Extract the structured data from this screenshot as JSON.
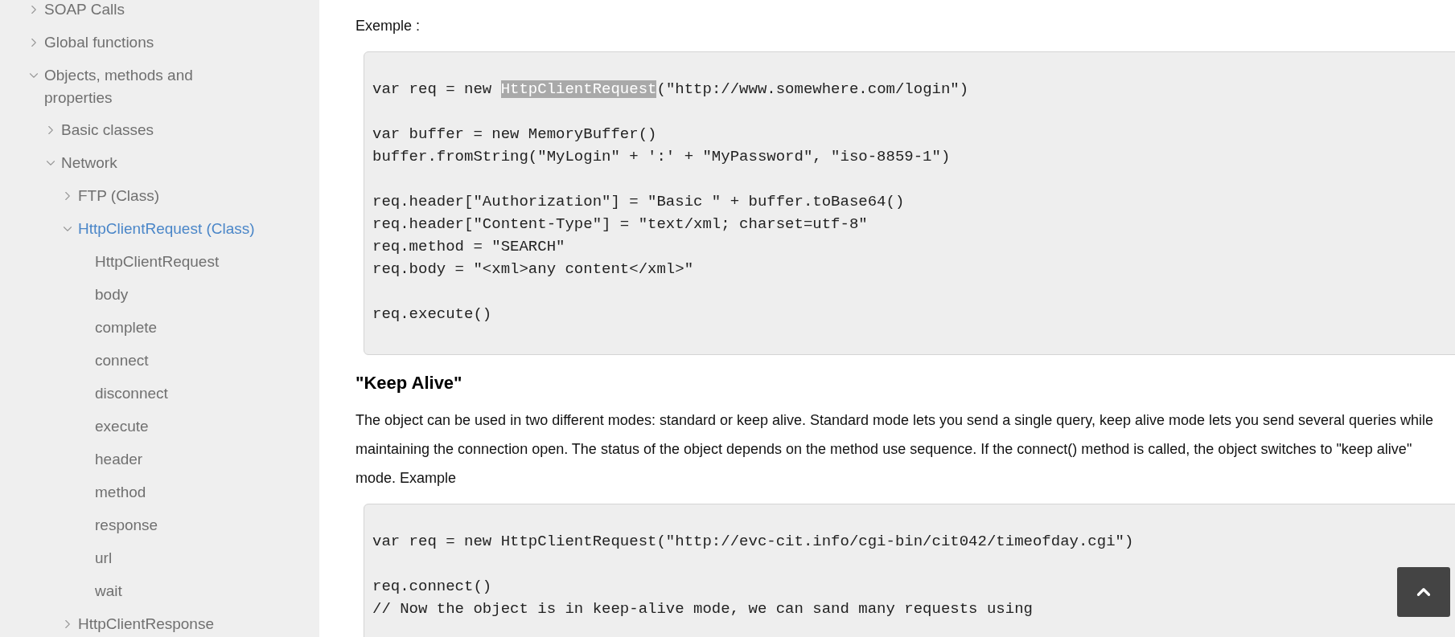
{
  "sidebar": {
    "items": [
      {
        "label": "SOAP Calls",
        "kind": "folder",
        "expanded": false,
        "selected": false
      },
      {
        "label": "Global functions",
        "kind": "folder",
        "expanded": false,
        "selected": false
      },
      {
        "label": "Objects, methods and properties",
        "kind": "folder",
        "expanded": true,
        "selected": false,
        "children": [
          {
            "label": "Basic classes",
            "kind": "folder",
            "expanded": false,
            "selected": false
          },
          {
            "label": "Network",
            "kind": "folder",
            "expanded": true,
            "selected": false,
            "children": [
              {
                "label": "FTP (Class)",
                "kind": "folder",
                "expanded": false,
                "selected": false
              },
              {
                "label": "HttpClientRequest (Class)",
                "kind": "folder",
                "expanded": true,
                "selected": true,
                "children": [
                  {
                    "label": "HttpClientRequest",
                    "kind": "leaf",
                    "selected": false
                  },
                  {
                    "label": "body",
                    "kind": "leaf",
                    "selected": false
                  },
                  {
                    "label": "complete",
                    "kind": "leaf",
                    "selected": false
                  },
                  {
                    "label": "connect",
                    "kind": "leaf",
                    "selected": false
                  },
                  {
                    "label": "disconnect",
                    "kind": "leaf",
                    "selected": false
                  },
                  {
                    "label": "execute",
                    "kind": "leaf",
                    "selected": false
                  },
                  {
                    "label": "header",
                    "kind": "leaf",
                    "selected": false
                  },
                  {
                    "label": "method",
                    "kind": "leaf",
                    "selected": false
                  },
                  {
                    "label": "response",
                    "kind": "leaf",
                    "selected": false
                  },
                  {
                    "label": "url",
                    "kind": "leaf",
                    "selected": false
                  },
                  {
                    "label": "wait",
                    "kind": "leaf",
                    "selected": false
                  }
                ]
              },
              {
                "label": "HttpClientResponse",
                "kind": "folder",
                "expanded": false,
                "selected": false
              }
            ]
          }
        ]
      }
    ]
  },
  "content": [
    {
      "kind": "text",
      "text": "Exemple :"
    },
    {
      "kind": "code",
      "groups": [
        [
          [
            {
              "text": "var req = new "
            },
            {
              "text": "HttpClientRequest",
              "highlighted": true
            },
            {
              "text": "(\"http://www.somewhere.com/login\")"
            }
          ]
        ],
        [
          [
            {
              "text": "var buffer = new MemoryBuffer()"
            }
          ],
          [
            {
              "text": "buffer.fromString(\"MyLogin\" + ':' + \"MyPassword\", \"iso-8859-1\")"
            }
          ]
        ],
        [
          [
            {
              "text": "req.header[\"Authorization\"] = \"Basic \" + buffer.toBase64()"
            }
          ],
          [
            {
              "text": "req.header[\"Content-Type\"] = \"text/xml; charset=utf-8\""
            }
          ],
          [
            {
              "text": "req.method = \"SEARCH\""
            }
          ],
          [
            {
              "text": "req.body = \"<xml>any content</xml>\""
            }
          ]
        ],
        [
          [
            {
              "text": "req.execute()"
            }
          ]
        ]
      ]
    },
    {
      "kind": "heading",
      "text": "\"Keep Alive\""
    },
    {
      "kind": "text",
      "text": "The object can be used in two different modes: standard or keep alive. Standard mode lets you send a single query, keep alive mode lets you send several queries while maintaining the connection open. The status of the object depends on the method use sequence. If the connect() method is called, the object switches to \"keep alive\" mode. Example"
    },
    {
      "kind": "code",
      "groups": [
        [
          [
            {
              "text": "var req = new HttpClientRequest(\"http://evc-cit.info/cgi-bin/cit042/timeofday.cgi\")"
            }
          ]
        ],
        [
          [
            {
              "text": "req.connect()"
            }
          ],
          [
            {
              "text": "// Now the object is in keep-alive mode, we can sand many requests using"
            }
          ]
        ]
      ]
    }
  ]
}
